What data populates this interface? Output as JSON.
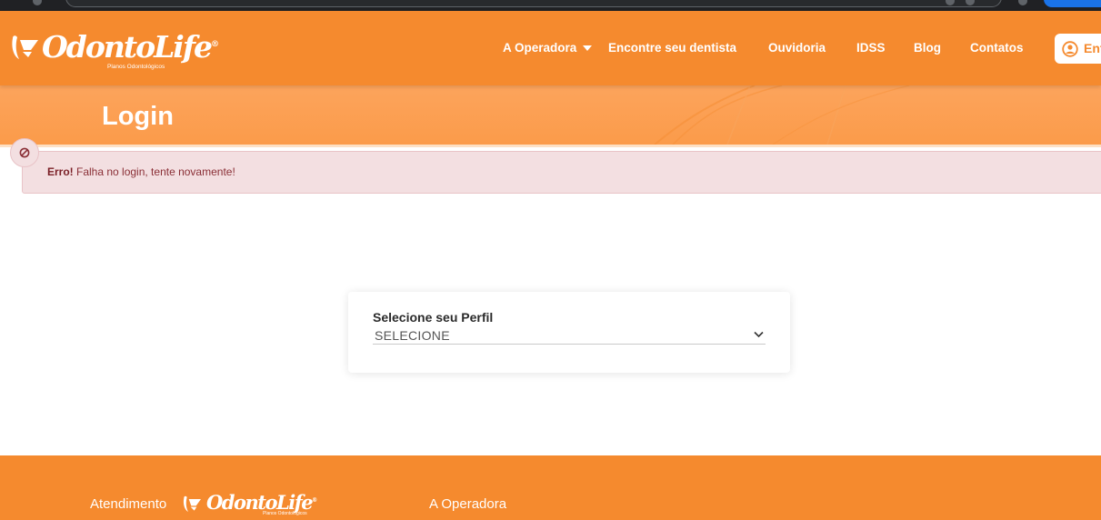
{
  "brand": {
    "name": "OdontoLife",
    "registered_mark": "®",
    "tagline": "Planos Odontológicos",
    "colors": {
      "primary": "#f58a2e",
      "banner": "#fca45c",
      "alert_bg": "#f3dfe1",
      "alert_text": "#8a2f36"
    }
  },
  "nav": {
    "items": [
      {
        "label": "A Operadora",
        "has_dropdown": true
      },
      {
        "label": "Encontre seu dentista"
      },
      {
        "label": "Ouvidoria"
      },
      {
        "label": "IDSS"
      },
      {
        "label": "Blog"
      },
      {
        "label": "Contatos"
      }
    ],
    "enter_button": {
      "label": "Ent",
      "icon": "user-circle-icon"
    }
  },
  "page": {
    "title": "Login"
  },
  "alert": {
    "icon": "ban-icon",
    "strong": "Erro!",
    "message": " Falha no login, tente novamente!"
  },
  "profile_form": {
    "label": "Selecione seu Perfil",
    "selected": "SELECIONE"
  },
  "footer": {
    "atendimento_label": "Atendimento",
    "operadora_label": "A Operadora"
  }
}
